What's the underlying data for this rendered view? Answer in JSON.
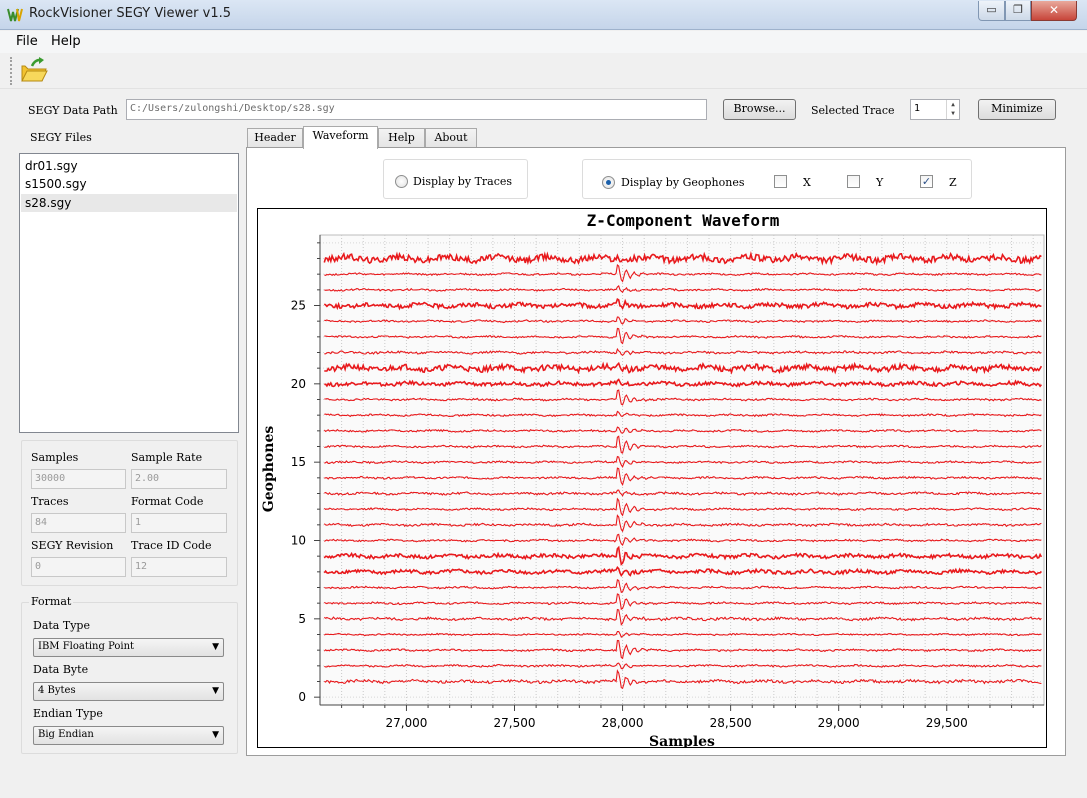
{
  "window": {
    "title": "RockVisioner SEGY Viewer v1.5",
    "min_glyph": "▭",
    "max_glyph": "❐",
    "close_glyph": "✕"
  },
  "menu": {
    "file": "File",
    "help": "Help"
  },
  "toolbar": {
    "open_icon": "folder-open-icon"
  },
  "path": {
    "label": "SEGY Data Path",
    "value": "C:/Users/zulongshi/Desktop/s28.sgy",
    "browse": "Browse..."
  },
  "trace": {
    "label": "Selected Trace",
    "value": "1"
  },
  "minimize_label": "Minimize",
  "files": {
    "label": "SEGY Files",
    "items": [
      "dr01.sgy",
      "s1500.sgy",
      "s28.sgy"
    ],
    "selected": "s28.sgy"
  },
  "info": {
    "samples_label": "Samples",
    "samples": "30000",
    "rate_label": "Sample Rate",
    "rate": "2.00",
    "traces_label": "Traces",
    "traces": "84",
    "format_label": "Format Code",
    "format": "1",
    "revision_label": "SEGY Revision",
    "revision": "0",
    "traceid_label": "Trace ID Code",
    "traceid": "12"
  },
  "format": {
    "title": "Format",
    "data_type_label": "Data Type",
    "data_type": "IBM Floating Point",
    "data_byte_label": "Data Byte",
    "data_byte": "4 Bytes",
    "endian_label": "Endian Type",
    "endian": "Big Endian"
  },
  "tabs": [
    "Header",
    "Waveform",
    "Help",
    "About"
  ],
  "active_tab": "Waveform",
  "display": {
    "by_traces": "Display by Traces",
    "by_geophones": "Display by Geophones",
    "selected": "by_geophones",
    "x": "X",
    "y": "Y",
    "z": "Z",
    "x_checked": false,
    "y_checked": false,
    "z_checked": true,
    "check_glyph": "✓"
  },
  "chart_data": {
    "type": "line",
    "title": "Z-Component Waveform",
    "xlabel": "Samples",
    "ylabel": "Geophones",
    "xlim": [
      26600,
      29950
    ],
    "ylim": [
      -0.5,
      29.5
    ],
    "xticks": [
      27000,
      27500,
      28000,
      28500,
      29000,
      29500
    ],
    "xtick_labels": [
      "27,000",
      "27,500",
      "28,000",
      "28,500",
      "29,000",
      "29,500"
    ],
    "yticks": [
      0,
      5,
      10,
      15,
      20,
      25
    ],
    "grid": true,
    "color": "#e8191c",
    "event_sample": 27970,
    "traces": [
      {
        "geophone": 1,
        "noise": 0.08,
        "event": 0.9
      },
      {
        "geophone": 2,
        "noise": 0.05,
        "event": 0.3
      },
      {
        "geophone": 3,
        "noise": 0.05,
        "event": 1.0
      },
      {
        "geophone": 4,
        "noise": 0.04,
        "event": 0.3
      },
      {
        "geophone": 5,
        "noise": 0.07,
        "event": 0.8
      },
      {
        "geophone": 6,
        "noise": 0.05,
        "event": 0.9
      },
      {
        "geophone": 7,
        "noise": 0.05,
        "event": 0.7
      },
      {
        "geophone": 8,
        "noise": 0.1,
        "event": 0.3
      },
      {
        "geophone": 9,
        "noise": 0.1,
        "event": 0.9
      },
      {
        "geophone": 10,
        "noise": 0.05,
        "event": 0.6
      },
      {
        "geophone": 11,
        "noise": 0.06,
        "event": 0.9
      },
      {
        "geophone": 12,
        "noise": 0.05,
        "event": 0.9
      },
      {
        "geophone": 13,
        "noise": 0.06,
        "event": 0.3
      },
      {
        "geophone": 14,
        "noise": 0.05,
        "event": 0.9
      },
      {
        "geophone": 15,
        "noise": 0.05,
        "event": 0.5
      },
      {
        "geophone": 16,
        "noise": 0.05,
        "event": 1.0
      },
      {
        "geophone": 17,
        "noise": 0.05,
        "event": 0.4
      },
      {
        "geophone": 18,
        "noise": 0.05,
        "event": 0.3
      },
      {
        "geophone": 19,
        "noise": 0.05,
        "event": 0.9
      },
      {
        "geophone": 20,
        "noise": 0.1,
        "event": 0.3
      },
      {
        "geophone": 21,
        "noise": 0.16,
        "event": 0.3
      },
      {
        "geophone": 22,
        "noise": 0.06,
        "event": 0.3
      },
      {
        "geophone": 23,
        "noise": 0.05,
        "event": 0.9
      },
      {
        "geophone": 24,
        "noise": 0.05,
        "event": 0.4
      },
      {
        "geophone": 25,
        "noise": 0.12,
        "event": 0.4
      },
      {
        "geophone": 26,
        "noise": 0.05,
        "event": 0.3
      },
      {
        "geophone": 27,
        "noise": 0.05,
        "event": 0.9
      },
      {
        "geophone": 28,
        "noise": 0.18,
        "event": 0.3
      }
    ]
  }
}
